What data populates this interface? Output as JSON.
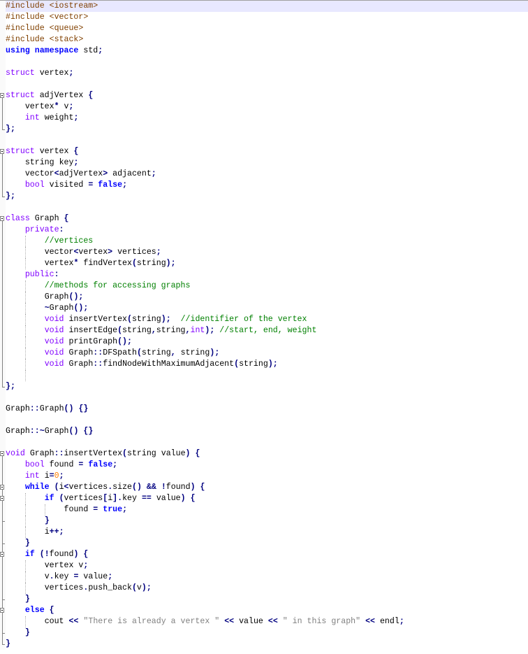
{
  "editor": {
    "current_line": 1,
    "lines": [
      "#include <iostream>",
      "#include <vector>",
      "#include <queue>",
      "#include <stack>",
      "using namespace std;",
      "",
      "struct vertex;",
      "",
      "struct adjVertex {",
      "    vertex* v;",
      "    int weight;",
      "};",
      "",
      "struct vertex {",
      "    string key;",
      "    vector<adjVertex> adjacent;",
      "    bool visited = false;",
      "};",
      "",
      "class Graph {",
      "    private:",
      "        //vertices",
      "        vector<vertex> vertices;",
      "        vertex* findVertex(string);",
      "    public:",
      "        //methods for accessing graphs",
      "        Graph();",
      "        ~Graph();",
      "        void insertVertex(string);  //identifier of the vertex",
      "        void insertEdge(string,string,int); //start, end, weight",
      "        void printGraph();",
      "        void Graph::DFSpath(string, string);",
      "        void Graph::findNodeWithMaximumAdjacent(string);",
      "        ",
      "};",
      "",
      "Graph::Graph() {}",
      "",
      "Graph::~Graph() {}",
      "",
      "void Graph::insertVertex(string value) {",
      "    bool found = false;",
      "    int i=0;",
      "    while (i<vertices.size() && !found) {",
      "        if (vertices[i].key == value) {",
      "            found = true;",
      "        }",
      "        i++;",
      "    }",
      "    if (!found) {",
      "        vertex v;",
      "        v.key = value;",
      "        vertices.push_back(v);",
      "    }",
      "    else {",
      "        cout << \"There is already a vertex \" << value << \" in this graph\" << endl;",
      "    }",
      "}"
    ]
  },
  "colors": {
    "current_line_bg": "#e8e8ff",
    "preprocessor": "#804000",
    "keyword": "#0000ff",
    "type": "#8000ff",
    "operator": "#000080",
    "comment": "#008000",
    "number": "#ff8000",
    "string": "#808080"
  }
}
